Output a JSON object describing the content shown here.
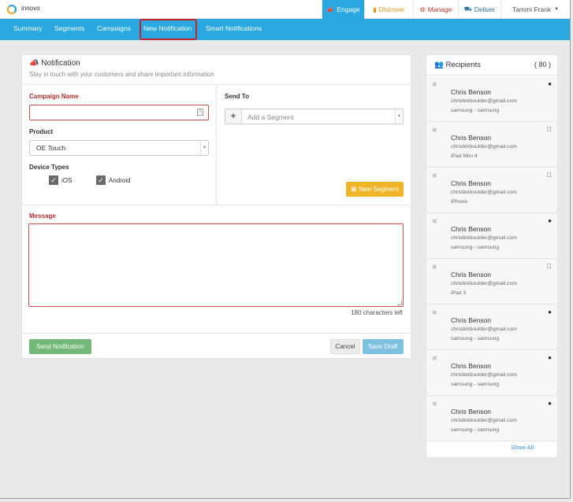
{
  "app": {
    "brand": "innovo"
  },
  "topnav": {
    "engage": "Engage",
    "discover": "Discover",
    "manage": "Manage",
    "deliver": "Deliver",
    "user": "Tammi Frank",
    "colors": {
      "engage_bg": "#29a7df",
      "discover": "#e5931c",
      "manage": "#c0392b",
      "deliver": "#2b6fa3"
    }
  },
  "subnav": {
    "tabs": [
      "Summary",
      "Segments",
      "Campaigns",
      "New Notification",
      "Smart Notifications"
    ],
    "active": "New Notification"
  },
  "form": {
    "title": "Notification",
    "subtitle": "Stay in touch with your customers and share important information",
    "campaign_label": "Campaign Name",
    "campaign_value": "",
    "product_label": "Product",
    "product_value": "OE Touch",
    "device_label": "Device Types",
    "devices": [
      {
        "label": "iOS",
        "checked": true
      },
      {
        "label": "Android",
        "checked": true
      }
    ],
    "send_to_label": "Send To",
    "segment_placeholder": "Add a Segment",
    "new_segment_label": "New Segment",
    "message_label": "Message",
    "message_value": "",
    "chars_left": "180 characters left",
    "send_button": "Send Notification",
    "cancel_button": "Cancel",
    "draft_button": "Save Draft"
  },
  "recipients": {
    "title": "Recipients",
    "count": "( 80 )",
    "items": [
      {
        "name": "Chris Benson",
        "email": "chrisbinboulder@gmail.com",
        "device": "samsung - samsung",
        "platform": "android-icon"
      },
      {
        "name": "Chris Benson",
        "email": "chrisbinboulder@gmail.com",
        "device": "iPad Mini 4",
        "platform": "apple-icon"
      },
      {
        "name": "Chris Benson",
        "email": "chrisbinboulder@gmail.com",
        "device": "iPhone",
        "platform": "apple-icon"
      },
      {
        "name": "Chris Benson",
        "email": "chrisbinboulder@gmail.com",
        "device": "samsung - samsung",
        "platform": "android-icon"
      },
      {
        "name": "Chris Benson",
        "email": "chrisbinboulder@gmail.com",
        "device": "iPad 3",
        "platform": "apple-icon"
      },
      {
        "name": "Chris Benson",
        "email": "chrisbinboulder@gmail.com",
        "device": "samsung - samsung",
        "platform": "android-icon"
      },
      {
        "name": "Chris Benson",
        "email": "chrisbinboulder@gmail.com",
        "device": "samsung - samsung",
        "platform": "android-icon"
      },
      {
        "name": "Chris Benson",
        "email": "chrisbinboulder@gmail.com",
        "device": "samsung - samsung",
        "platform": "android-icon"
      }
    ],
    "show_all": "Show All"
  }
}
